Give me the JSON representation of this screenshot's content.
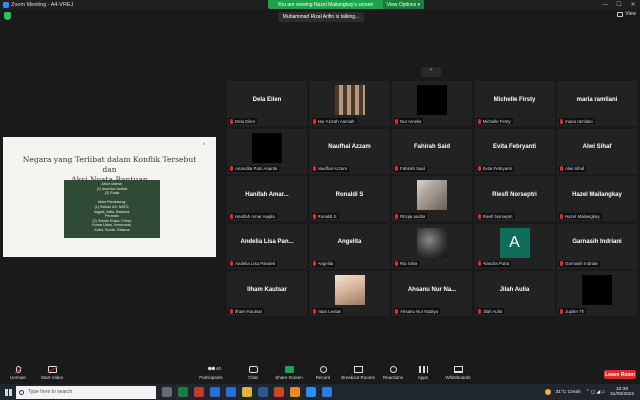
{
  "window": {
    "title": "Zoom Meeting - A4-VREJ",
    "minimize": "—",
    "maximize": "☐",
    "close": "✕"
  },
  "banner": {
    "text": "You are viewing Nazel Mailangkay's screen",
    "options": "View Options ▾"
  },
  "talking_indicator": "Muhammad Rizal Arifin is talking...",
  "view_button": "View",
  "slide": {
    "page_number": "5",
    "title_line1": "Negara yang Terlibat dalam Konflik Tersebut dan",
    "title_line2": "Aksi Nyata Bantuan",
    "box_lines": [
      "Aktor Utama:",
      "(1) Amerika Serikat",
      "(2) Rusia",
      "",
      "Aktor Pendukung:",
      "(1) Sekutu AS: NATO,",
      "Inggris, Italia, Belanda,",
      "Perancis",
      "(2) Sekutu Rusia: China,",
      "Korea Utara, Venezuela,",
      "Kuba, Suriah, Belarus"
    ]
  },
  "scroll_up": "⌃",
  "participants": [
    {
      "id": "dela",
      "center": "Dela Eilen",
      "footer": "Dela Eilen",
      "video": "none"
    },
    {
      "id": "nur-azizah",
      "center": "",
      "footer": "Nur Azizah Aamiah",
      "video": "photo1"
    },
    {
      "id": "nur-amelia",
      "center": "",
      "footer": "Nur Amelia",
      "video": "black"
    },
    {
      "id": "michelle",
      "center": "Michelle Firsty",
      "footer": "Michelle Firsty",
      "video": "none"
    },
    {
      "id": "maria",
      "center": "maria ramliani",
      "footer": "maria ramliani",
      "video": "none"
    },
    {
      "id": "anandita",
      "center": "",
      "footer": "Anandita Putri Ananta",
      "video": "black"
    },
    {
      "id": "naufhal",
      "center": "Naufhal Azzam",
      "footer": "Naufhal Azzam",
      "video": "none"
    },
    {
      "id": "fahirah",
      "center": "Fahirah Said",
      "footer": "Fahirah Said",
      "video": "none"
    },
    {
      "id": "evita",
      "center": "Evita Febryanti",
      "footer": "Evita Febryanti",
      "video": "none"
    },
    {
      "id": "alwi",
      "center": "Alwi Sihaf",
      "footer": "Alwi Sihaf",
      "video": "none"
    },
    {
      "id": "hanifah",
      "center": "Hanifah  Amar...",
      "footer": "Hanifah Amar Aaqila",
      "video": "none"
    },
    {
      "id": "ronaldi",
      "center": "Ronaldi S",
      "footer": "Ronaldi S",
      "video": "none"
    },
    {
      "id": "rizqia",
      "center": "",
      "footer": "Rizqia andita",
      "video": "photo2"
    },
    {
      "id": "riesfi",
      "center": "Riesfi Norseptri",
      "footer": "Riesfi Norseptri",
      "video": "none"
    },
    {
      "id": "hazel",
      "center": "Hazel Mailangkay",
      "footer": "Hazel Mailangkay",
      "video": "none"
    },
    {
      "id": "andelia",
      "center": "Andelia Lisa Pan...",
      "footer": "Andelia Lisa Pandeti",
      "video": "none"
    },
    {
      "id": "angelita",
      "center": "Angelita",
      "footer": "Angelita",
      "video": "none"
    },
    {
      "id": "ria",
      "center": "",
      "footer": "Ria Silva",
      "video": "photo3"
    },
    {
      "id": "alandra",
      "center": "",
      "footer": "Alandra Putra",
      "video": "avatar",
      "avatar_letter": "A"
    },
    {
      "id": "garnasih",
      "center": "Garnasih Indriani",
      "footer": "Garnasih Indriani",
      "video": "none"
    },
    {
      "id": "ilham",
      "center": "Ilham Kautsar",
      "footer": "Ilham Kautsar",
      "video": "none"
    },
    {
      "id": "intan",
      "center": "",
      "footer": "intan Lestari",
      "video": "photo4"
    },
    {
      "id": "ahsanu",
      "center": "Ahsanu Nur Na...",
      "footer": "Ahsanu Nur Nadiya",
      "video": "none"
    },
    {
      "id": "jilah",
      "center": "Jilah Aulia",
      "footer": "Jilah Aulia",
      "video": "none"
    },
    {
      "id": "jupiter",
      "center": "",
      "footer": "Jupiter Th",
      "video": "black"
    }
  ],
  "toolbar": {
    "unmute": "Unmute",
    "start_video": "Start Video",
    "participants": "Participants",
    "participant_count": "40",
    "chat": "Chat",
    "share_screen": "Share Screen",
    "record": "Record",
    "breakout_rooms": "Breakout Rooms",
    "reactions": "Reactions",
    "apps": "Apps",
    "whiteboards": "Whiteboards",
    "leave": "Leave Room"
  },
  "taskbar": {
    "search_placeholder": "Type here to search",
    "weather": "31°C  Cerah",
    "time": "10:39",
    "date": "31/05/2022",
    "tray_icons": "⌃  ◻  ◢  ♫"
  },
  "colors": {
    "accent_green": "#1ea34b",
    "leave_red": "#e02828",
    "avatar_teal": "#0f6e5a"
  }
}
